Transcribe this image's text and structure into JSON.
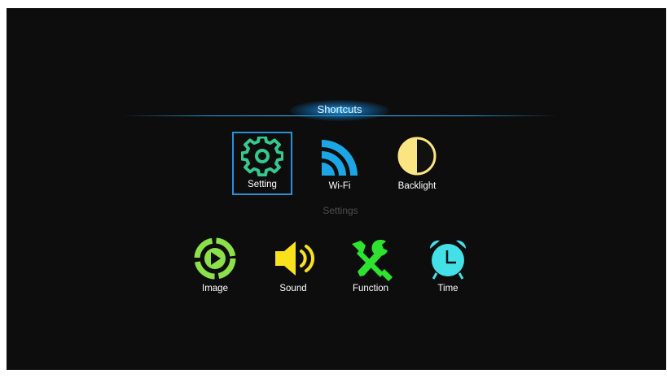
{
  "header": {
    "title": "Shortcuts"
  },
  "shortcuts": [
    {
      "label": "Setting",
      "icon": "gear-icon",
      "color": "#35c98e",
      "selected": true
    },
    {
      "label": "Wi-Fi",
      "icon": "wifi-icon",
      "color": "#1ba7e6",
      "selected": false
    },
    {
      "label": "Backlight",
      "icon": "backlight-icon",
      "color": "#fbe583",
      "selected": false
    }
  ],
  "settings_section": {
    "title": "Settings"
  },
  "settings": [
    {
      "label": "Image",
      "icon": "play-circle-icon",
      "color": "#8ce04a"
    },
    {
      "label": "Sound",
      "icon": "speaker-icon",
      "color": "#f9e11c"
    },
    {
      "label": "Function",
      "icon": "tools-icon",
      "color": "#2ee22f"
    },
    {
      "label": "Time",
      "icon": "alarm-clock-icon",
      "color": "#44e0e8"
    }
  ]
}
